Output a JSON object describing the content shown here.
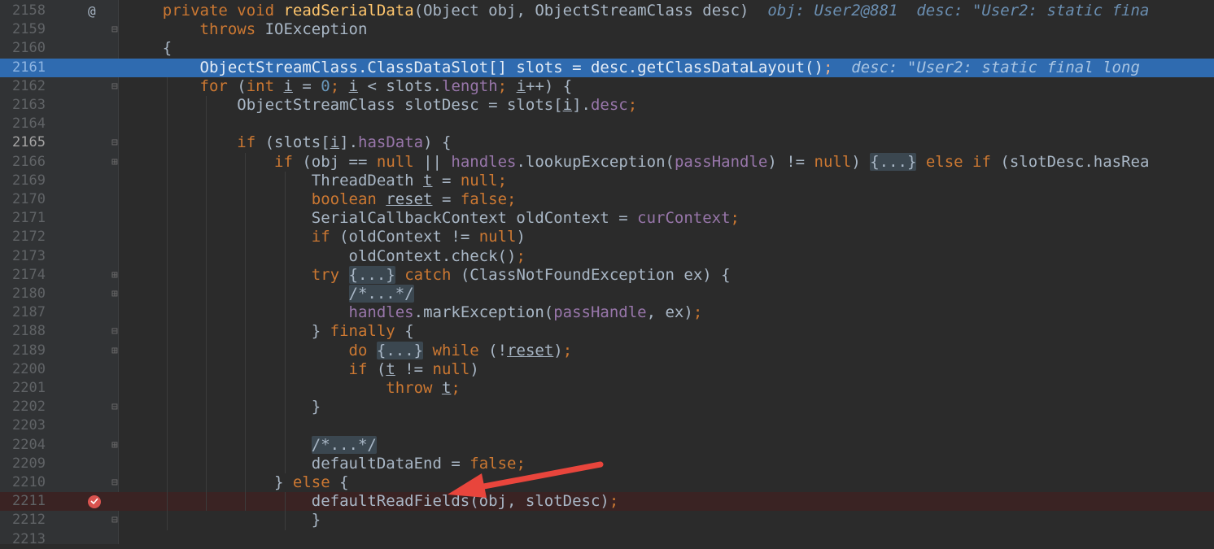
{
  "editor": {
    "lines": [
      {
        "num": "2158",
        "gutter": "at",
        "tokens": [
          [
            "    ",
            ""
          ],
          [
            "private ",
            "kw"
          ],
          [
            "void ",
            "kw"
          ],
          [
            "readSerialData",
            "fn"
          ],
          [
            "(Object obj, ObjectStreamClass desc)",
            ""
          ],
          [
            "  obj: User2@881  desc: \"User2: static fina",
            "hint"
          ]
        ]
      },
      {
        "num": "2159",
        "gutter": "fold-start",
        "tokens": [
          [
            "        ",
            ""
          ],
          [
            "throws ",
            "kw"
          ],
          [
            "IOException",
            ""
          ]
        ]
      },
      {
        "num": "2160",
        "gutter": "",
        "tokens": [
          [
            "    {",
            ""
          ]
        ]
      },
      {
        "num": "2161",
        "gutter": "",
        "current": true,
        "tokens": [
          [
            "        ObjectStreamClass.ClassDataSlot[] slots = desc.getClassDataLayout()",
            ""
          ],
          [
            ";",
            "kw"
          ],
          [
            "  desc: \"User2: static final long",
            "hint"
          ]
        ]
      },
      {
        "num": "2162",
        "gutter": "fold-start",
        "tokens": [
          [
            "        ",
            ""
          ],
          [
            "for ",
            "kw"
          ],
          [
            "(",
            ""
          ],
          [
            "int ",
            "kw"
          ],
          [
            "i",
            "und"
          ],
          [
            " = ",
            ""
          ],
          [
            "0",
            "num"
          ],
          [
            "; ",
            "kw"
          ],
          [
            "i",
            "und"
          ],
          [
            " < slots.",
            ""
          ],
          [
            "length",
            "fld"
          ],
          [
            "; ",
            "kw"
          ],
          [
            "i",
            "und"
          ],
          [
            "++) {",
            ""
          ]
        ]
      },
      {
        "num": "2163",
        "gutter": "",
        "tokens": [
          [
            "            ObjectStreamClass slotDesc = slots[",
            ""
          ],
          [
            "i",
            "und"
          ],
          [
            "].",
            ""
          ],
          [
            "desc",
            "fld"
          ],
          [
            ";",
            "kw"
          ]
        ]
      },
      {
        "num": "2164",
        "gutter": "",
        "tokens": []
      },
      {
        "num": "2165",
        "gutter": "fold-start",
        "caret": true,
        "tokens": [
          [
            "            ",
            ""
          ],
          [
            "if ",
            "kw"
          ],
          [
            "(slots[",
            ""
          ],
          [
            "i",
            "und"
          ],
          [
            "].",
            ""
          ],
          [
            "hasData",
            "fld"
          ],
          [
            ") {",
            ""
          ]
        ]
      },
      {
        "num": "2166",
        "gutter": "fold-collapsed",
        "tokens": [
          [
            "                ",
            ""
          ],
          [
            "if ",
            "kw"
          ],
          [
            "(obj == ",
            ""
          ],
          [
            "null ",
            "kw"
          ],
          [
            "|| ",
            ""
          ],
          [
            "handles",
            "fld"
          ],
          [
            ".lookupException(",
            ""
          ],
          [
            "passHandle",
            "fld"
          ],
          [
            ") != ",
            ""
          ],
          [
            "null",
            "kw"
          ],
          [
            ") ",
            ""
          ],
          [
            "{...}",
            "fold"
          ],
          [
            " ",
            ""
          ],
          [
            "else if ",
            "kw"
          ],
          [
            "(slotDesc.hasRea",
            ""
          ]
        ]
      },
      {
        "num": "2169",
        "gutter": "",
        "tokens": [
          [
            "                    ThreadDeath ",
            ""
          ],
          [
            "t",
            "und"
          ],
          [
            " = ",
            ""
          ],
          [
            "null",
            "kw"
          ],
          [
            ";",
            "kw"
          ]
        ]
      },
      {
        "num": "2170",
        "gutter": "",
        "tokens": [
          [
            "                    ",
            ""
          ],
          [
            "boolean ",
            "kw"
          ],
          [
            "reset",
            "und"
          ],
          [
            " = ",
            ""
          ],
          [
            "false",
            "kw"
          ],
          [
            ";",
            "kw"
          ]
        ]
      },
      {
        "num": "2171",
        "gutter": "",
        "tokens": [
          [
            "                    SerialCallbackContext oldContext = ",
            ""
          ],
          [
            "curContext",
            "fld"
          ],
          [
            ";",
            "kw"
          ]
        ]
      },
      {
        "num": "2172",
        "gutter": "",
        "tokens": [
          [
            "                    ",
            ""
          ],
          [
            "if ",
            "kw"
          ],
          [
            "(oldContext != ",
            ""
          ],
          [
            "null",
            "kw"
          ],
          [
            ")",
            ""
          ]
        ]
      },
      {
        "num": "2173",
        "gutter": "",
        "tokens": [
          [
            "                        oldContext.check()",
            ""
          ],
          [
            ";",
            "kw"
          ]
        ]
      },
      {
        "num": "2174",
        "gutter": "fold-collapsed",
        "tokens": [
          [
            "                    ",
            ""
          ],
          [
            "try ",
            "kw"
          ],
          [
            "{...}",
            "fold"
          ],
          [
            " ",
            ""
          ],
          [
            "catch ",
            "kw"
          ],
          [
            "(ClassNotFoundException ex) {",
            ""
          ]
        ]
      },
      {
        "num": "2180",
        "gutter": "fold-collapsed",
        "tokens": [
          [
            "                        ",
            ""
          ],
          [
            "/*...*/",
            "cm fold"
          ]
        ]
      },
      {
        "num": "2187",
        "gutter": "",
        "tokens": [
          [
            "                        ",
            ""
          ],
          [
            "handles",
            "fld"
          ],
          [
            ".markException(",
            ""
          ],
          [
            "passHandle",
            "fld"
          ],
          [
            ", ex)",
            ""
          ],
          [
            ";",
            "kw"
          ]
        ]
      },
      {
        "num": "2188",
        "gutter": "fold-end",
        "tokens": [
          [
            "                    } ",
            ""
          ],
          [
            "finally ",
            "kw"
          ],
          [
            "{",
            ""
          ]
        ]
      },
      {
        "num": "2189",
        "gutter": "fold-collapsed",
        "tokens": [
          [
            "                        ",
            ""
          ],
          [
            "do ",
            "kw"
          ],
          [
            "{...}",
            "fold"
          ],
          [
            " ",
            ""
          ],
          [
            "while ",
            "kw"
          ],
          [
            "(!",
            ""
          ],
          [
            "reset",
            "und"
          ],
          [
            ")",
            ""
          ],
          [
            ";",
            "kw"
          ]
        ]
      },
      {
        "num": "2200",
        "gutter": "",
        "tokens": [
          [
            "                        ",
            ""
          ],
          [
            "if ",
            "kw"
          ],
          [
            "(",
            ""
          ],
          [
            "t",
            "und"
          ],
          [
            " != ",
            ""
          ],
          [
            "null",
            "kw"
          ],
          [
            ")",
            ""
          ]
        ]
      },
      {
        "num": "2201",
        "gutter": "",
        "tokens": [
          [
            "                            ",
            ""
          ],
          [
            "throw ",
            "kw"
          ],
          [
            "t",
            "und"
          ],
          [
            ";",
            "kw"
          ]
        ]
      },
      {
        "num": "2202",
        "gutter": "fold-end",
        "tokens": [
          [
            "                    }",
            ""
          ]
        ]
      },
      {
        "num": "2203",
        "gutter": "",
        "tokens": []
      },
      {
        "num": "2204",
        "gutter": "fold-collapsed",
        "tokens": [
          [
            "                    ",
            ""
          ],
          [
            "/*...*/",
            "cm fold"
          ]
        ]
      },
      {
        "num": "2209",
        "gutter": "",
        "tokens": [
          [
            "                    defaultDataEnd = ",
            ""
          ],
          [
            "false",
            "kw"
          ],
          [
            ";",
            "kw"
          ]
        ]
      },
      {
        "num": "2210",
        "gutter": "fold-start",
        "tokens": [
          [
            "                } ",
            ""
          ],
          [
            "else ",
            "kw"
          ],
          [
            "{",
            ""
          ]
        ]
      },
      {
        "num": "2211",
        "gutter": "breakpoint",
        "breakpoint": true,
        "tokens": [
          [
            "                    defaultReadFields(obj, slotDesc)",
            ""
          ],
          [
            ";",
            "kw"
          ]
        ]
      },
      {
        "num": "2212",
        "gutter": "fold-end",
        "tokens": [
          [
            "                    }",
            ""
          ]
        ]
      },
      {
        "num": "2213",
        "gutter": "",
        "tokens": []
      }
    ]
  },
  "gutter_icons": {
    "at": "@",
    "fold": "⊟",
    "fold_collapsed": "⊞"
  },
  "colors": {
    "background": "#2b2b2b",
    "gutter": "#313335",
    "current_line": "#2f6bb0",
    "breakpoint_line": "#3a2323",
    "keyword": "#cc7832",
    "method": "#ffc66d",
    "field": "#9876aa",
    "comment": "#808080",
    "number": "#6897bb",
    "text": "#a9b7c6",
    "arrow": "#e8453c",
    "breakpoint_icon": "#d9534f"
  },
  "annotation": {
    "icon": "red-arrow-icon"
  }
}
